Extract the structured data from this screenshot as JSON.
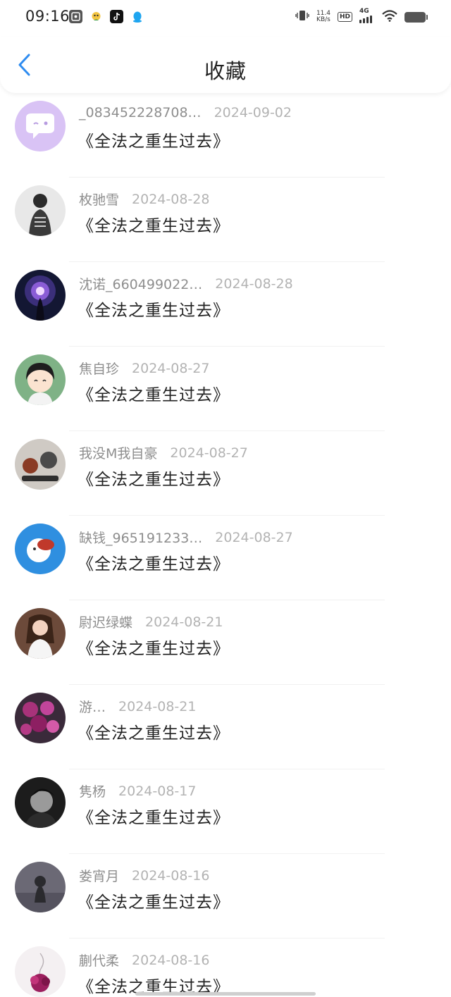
{
  "status_bar": {
    "time": "09:16",
    "net_speed_value": "11.4",
    "net_speed_unit": "KB/s",
    "hd": "HD",
    "network": "4G"
  },
  "header": {
    "title": "收藏"
  },
  "favorites": [
    {
      "username": "_083452228708…",
      "date": "2024-09-02",
      "book": "《全法之重生过去》"
    },
    {
      "username": "枚驰雪",
      "date": "2024-08-28",
      "book": "《全法之重生过去》"
    },
    {
      "username": "沈诺_660499022…",
      "date": "2024-08-28",
      "book": "《全法之重生过去》"
    },
    {
      "username": "焦自珍",
      "date": "2024-08-27",
      "book": "《全法之重生过去》"
    },
    {
      "username": "我没M我自豪",
      "date": "2024-08-27",
      "book": "《全法之重生过去》"
    },
    {
      "username": "缺钱_965191233…",
      "date": "2024-08-27",
      "book": "《全法之重生过去》"
    },
    {
      "username": "尉迟绿蝶",
      "date": "2024-08-21",
      "book": "《全法之重生过去》"
    },
    {
      "username": "游…",
      "date": "2024-08-21",
      "book": "《全法之重生过去》"
    },
    {
      "username": "隽杨",
      "date": "2024-08-17",
      "book": "《全法之重生过去》"
    },
    {
      "username": "娄宵月",
      "date": "2024-08-16",
      "book": "《全法之重生过去》"
    },
    {
      "username": "蒯代柔",
      "date": "2024-08-16",
      "book": "《全法之重生过去》"
    }
  ],
  "colors": {
    "accent": "#2f8cf0",
    "username": "#8e8e8e",
    "date": "#b3b3b3",
    "title": "#222222"
  }
}
